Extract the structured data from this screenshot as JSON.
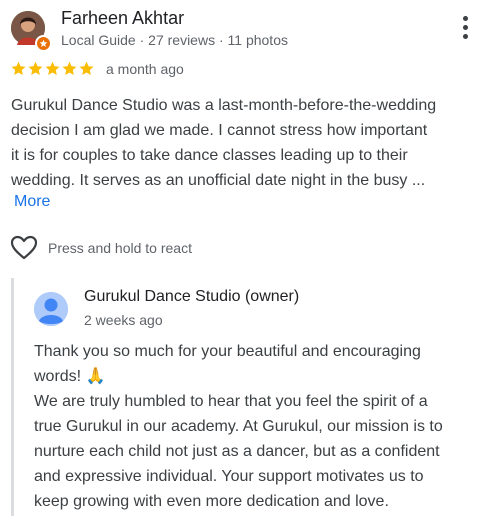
{
  "review": {
    "author": "Farheen Akhtar",
    "meta": "Local Guide · 27 reviews · 11 photos",
    "rating": 5,
    "rating_max": 5,
    "time": "a month ago",
    "text_lines": [
      "Gurukul Dance Studio was a last-month-before-the-wedding",
      "decision I am glad we made. I cannot stress how important",
      "it is for couples to take dance classes leading up to their",
      "wedding. It serves as an unofficial date night in the busy ..."
    ],
    "more_label": "More",
    "react_label": "Press and hold to react",
    "icons": {
      "menu": "more-vert-icon",
      "react": "heart-outline-icon",
      "badge": "local-guide-badge-icon",
      "star": "star-icon"
    },
    "colors": {
      "star": "#fbbc04",
      "link": "#1a73e8",
      "badge": "#e8710a"
    }
  },
  "owner_reply": {
    "author": "Gurukul Dance Studio (owner)",
    "time": "2 weeks ago",
    "text_lines": [
      "Thank you so much for your beautiful and encouraging",
      "words! 🙏",
      "We are truly humbled to hear that you feel the spirit of a",
      "true Gurukul in our academy. At Gurukul, our mission is to",
      "nurture each child not just as a dancer, but as a confident",
      "and expressive individual. Your support motivates us to",
      "keep growing with even more dedication and love."
    ]
  }
}
